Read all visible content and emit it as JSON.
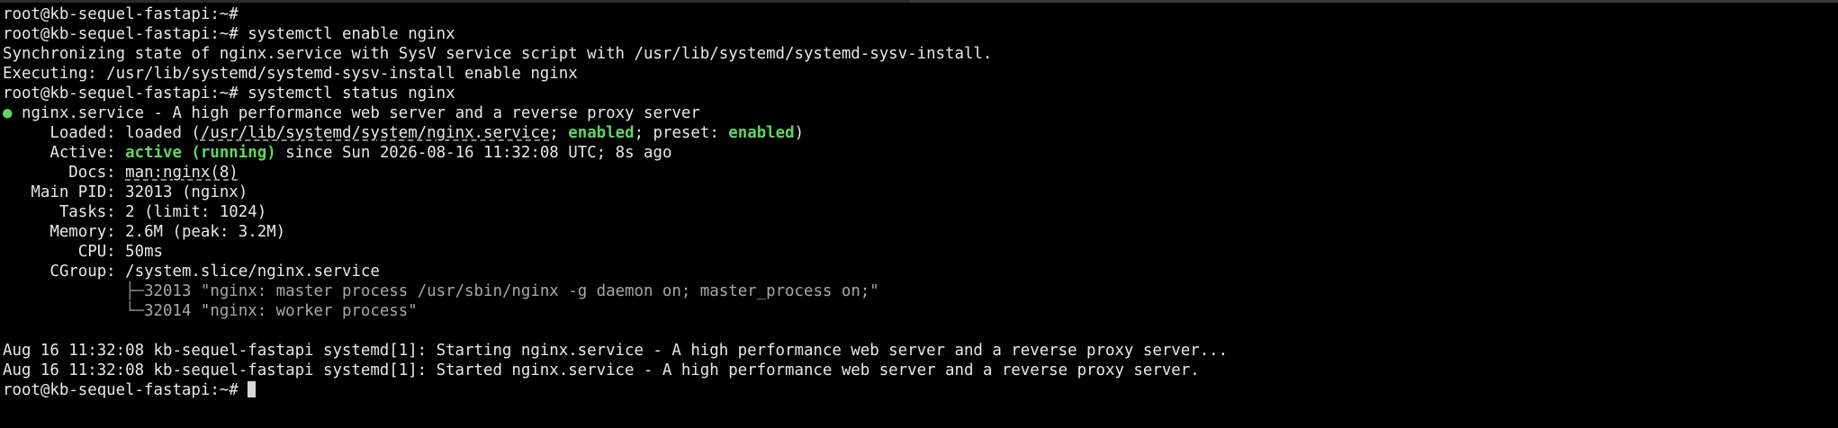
{
  "colors": {
    "background": "#000000",
    "foreground": "#e8e8e8",
    "accent_green": "#5fd75f",
    "tree_grey": "#8a8a8a"
  },
  "prompt": "root@kb-sequel-fastapi:~#",
  "commands": {
    "enable": "systemctl enable nginx",
    "status": "systemctl status nginx"
  },
  "output": {
    "sync": "Synchronizing state of nginx.service with SysV service script with /usr/lib/systemd/systemd-sysv-install.",
    "executing": "Executing: /usr/lib/systemd/systemd-sysv-install enable nginx"
  },
  "status": {
    "bullet": "●",
    "unit_line": "nginx.service - A high performance web server and a reverse proxy server",
    "loaded_label": "Loaded:",
    "loaded_prefix": "loaded (",
    "loaded_path": "/usr/lib/systemd/system/nginx.service",
    "loaded_sep": "; ",
    "loaded_state": "enabled",
    "loaded_preset_label": "; preset: ",
    "loaded_preset": "enabled",
    "loaded_suffix": ")",
    "active_label": "Active:",
    "active_state": "active (running)",
    "active_since": " since Sun 2026-08-16 11:32:08 UTC; 8s ago",
    "docs_label": "Docs:",
    "docs_value": "man:nginx(8)",
    "pid_label": "Main PID:",
    "pid_value": "32013 (nginx)",
    "tasks_label": "Tasks:",
    "tasks_value": "2 (limit: 1024)",
    "memory_label": "Memory:",
    "memory_value": "2.6M (peak: 3.2M)",
    "cpu_label": "CPU:",
    "cpu_value": "50ms",
    "cgroup_label": "CGroup:",
    "cgroup_value": "/system.slice/nginx.service",
    "process_1_branch": "├─",
    "process_1": "32013 \"nginx: master process /usr/sbin/nginx -g daemon on; master_process on;\"",
    "process_2_branch": "└─",
    "process_2": "32014 \"nginx: worker process\""
  },
  "journal": [
    "Aug 16 11:32:08 kb-sequel-fastapi systemd[1]: Starting nginx.service - A high performance web server and a reverse proxy server...",
    "Aug 16 11:32:08 kb-sequel-fastapi systemd[1]: Started nginx.service - A high performance web server and a reverse proxy server."
  ]
}
